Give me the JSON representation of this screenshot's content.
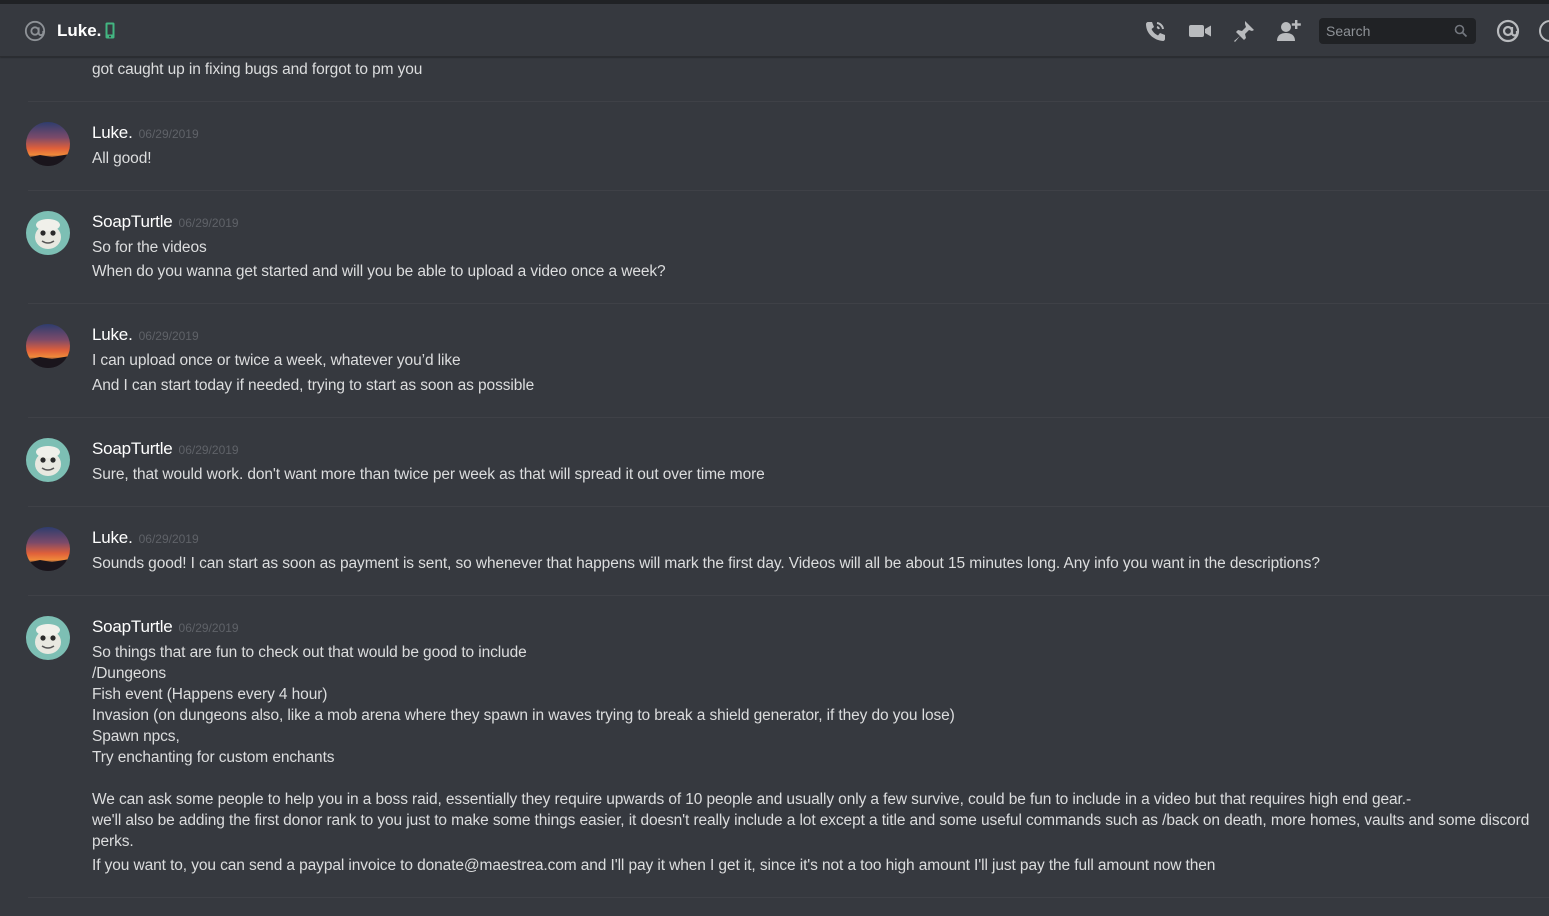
{
  "header": {
    "channel_name": "Luke.",
    "search_placeholder": "Search",
    "icons": [
      "at-icon",
      "mobile-status-icon",
      "voice-call-icon",
      "video-call-icon",
      "pin-icon",
      "add-friend-icon",
      "search-icon",
      "mention-icon"
    ],
    "colors": {
      "online_mobile": "#43b581",
      "background": "#36393f",
      "search_bg": "#202225"
    }
  },
  "messages": [
    {
      "continuation": true,
      "lines": [
        "got caught up in fixing bugs and forgot to pm you"
      ]
    },
    {
      "author": "Luke.",
      "timestamp": "06/29/2019",
      "lines": [
        "All good!"
      ]
    },
    {
      "author": "SoapTurtle",
      "timestamp": "06/29/2019",
      "lines": [
        "So for the videos",
        "When do you wanna get started and will you be able to upload a video once a week?"
      ]
    },
    {
      "author": "Luke.",
      "timestamp": "06/29/2019",
      "lines": [
        "I can upload once or twice a week, whatever you’d like",
        "And I can start today if needed, trying to start as soon as possible"
      ]
    },
    {
      "author": "SoapTurtle",
      "timestamp": "06/29/2019",
      "lines": [
        "Sure, that would work. don't want more than twice per week as that will spread it out over time more"
      ]
    },
    {
      "author": "Luke.",
      "timestamp": "06/29/2019",
      "lines": [
        "Sounds good! I can start as soon as payment is sent, so whenever that happens will mark the first day. Videos will all be about 15 minutes long. Any info you want in the descriptions?"
      ]
    },
    {
      "author": "SoapTurtle",
      "timestamp": "06/29/2019",
      "lines": [
        "So things that are fun to check out that would be good to include",
        "/Dungeons",
        "Fish event (Happens every 4 hour)",
        "Invasion (on dungeons also, like a mob arena where they spawn in waves trying to break a shield generator, if they do you lose)",
        "Spawn npcs,",
        "Try enchanting for custom enchants",
        "We can ask some people to help you in a boss raid, essentially they require upwards of 10 people and usually only a few survive, could be fun to include in a video but that requires high end gear.-",
        "we'll also be adding the first donor rank to you just to make some things easier, it doesn't really include a lot except a title and some useful commands such as /back on death, more homes, vaults and some discord",
        "perks.",
        "If you want to, you can send a paypal invoice to donate@maestrea.com and I'll pay it when I get it, since it's not a too high amount I'll just pay the full amount now then"
      ]
    }
  ]
}
